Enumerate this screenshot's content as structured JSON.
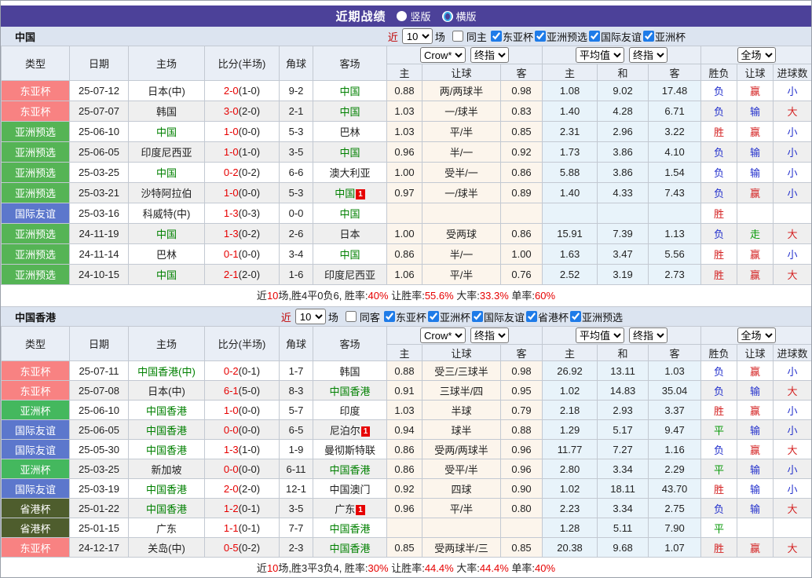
{
  "titlebar": {
    "title": "近期战绩",
    "options": [
      {
        "label": "竖版",
        "selected": true
      },
      {
        "label": "横版",
        "selected": false
      }
    ]
  },
  "columns": {
    "type": "类型",
    "date": "日期",
    "home": "主场",
    "score": "比分(半场)",
    "corner": "角球",
    "away": "客场",
    "bk_home": "主",
    "bk_handicap": "让球",
    "bk_away": "客",
    "avg_home": "主",
    "avg_draw": "和",
    "avg_away": "客",
    "res_wdl": "胜负",
    "res_handicap": "让球",
    "res_goals": "进球数"
  },
  "colors": {
    "accent_purple": "#4c4199",
    "self_team_green": "#008000",
    "score_red": "#e60000",
    "type_badges": {
      "东亚杯": "#f88282",
      "亚洲预选": "#55b455",
      "国际友谊": "#5c77cc",
      "亚洲杯": "#44b85e",
      "省港杯": "#4e5d2d"
    },
    "results": {
      "胜": "#d42222",
      "赢": "#d42222",
      "大": "#d42222",
      "负": "#2330cc",
      "输": "#2330cc",
      "小": "#2330cc",
      "平": "#0a9a0a",
      "走": "#0a9a0a"
    }
  },
  "sections": [
    {
      "team": "中国",
      "filter": {
        "near": "近",
        "count": "10",
        "games": "场",
        "same": "同主",
        "comps": [
          "东亚杯",
          "亚洲预选",
          "国际友谊",
          "亚洲杯"
        ]
      },
      "selects": {
        "bookmaker": "Crow*",
        "bk_period": "终指",
        "average": "平均值",
        "avg_period": "终指",
        "scope": "全场"
      },
      "rows": [
        {
          "type": "东亚杯",
          "date": "25-07-12",
          "home": "日本(中)",
          "home_self": false,
          "ft": "2-0",
          "ht": "(1-0)",
          "corner": "9-2",
          "away": "中国",
          "away_self": true,
          "mark": "",
          "bk": [
            "0.88",
            "两/两球半",
            "0.98"
          ],
          "avg": [
            "1.08",
            "9.02",
            "17.48"
          ],
          "res": [
            "负",
            "赢",
            "小"
          ]
        },
        {
          "type": "东亚杯",
          "date": "25-07-07",
          "home": "韩国",
          "home_self": false,
          "ft": "3-0",
          "ht": "(2-0)",
          "corner": "2-1",
          "away": "中国",
          "away_self": true,
          "mark": "",
          "bk": [
            "1.03",
            "一/球半",
            "0.83"
          ],
          "avg": [
            "1.40",
            "4.28",
            "6.71"
          ],
          "res": [
            "负",
            "输",
            "大"
          ]
        },
        {
          "type": "亚洲预选",
          "date": "25-06-10",
          "home": "中国",
          "home_self": true,
          "ft": "1-0",
          "ht": "(0-0)",
          "corner": "5-3",
          "away": "巴林",
          "away_self": false,
          "mark": "",
          "bk": [
            "1.03",
            "平/半",
            "0.85"
          ],
          "avg": [
            "2.31",
            "2.96",
            "3.22"
          ],
          "res": [
            "胜",
            "赢",
            "小"
          ]
        },
        {
          "type": "亚洲预选",
          "date": "25-06-05",
          "home": "印度尼西亚",
          "home_self": false,
          "ft": "1-0",
          "ht": "(1-0)",
          "corner": "3-5",
          "away": "中国",
          "away_self": true,
          "mark": "",
          "bk": [
            "0.96",
            "半/一",
            "0.92"
          ],
          "avg": [
            "1.73",
            "3.86",
            "4.10"
          ],
          "res": [
            "负",
            "输",
            "小"
          ]
        },
        {
          "type": "亚洲预选",
          "date": "25-03-25",
          "home": "中国",
          "home_self": true,
          "ft": "0-2",
          "ht": "(0-2)",
          "corner": "6-6",
          "away": "澳大利亚",
          "away_self": false,
          "mark": "",
          "bk": [
            "1.00",
            "受半/一",
            "0.86"
          ],
          "avg": [
            "5.88",
            "3.86",
            "1.54"
          ],
          "res": [
            "负",
            "输",
            "小"
          ]
        },
        {
          "type": "亚洲预选",
          "date": "25-03-21",
          "home": "沙特阿拉伯",
          "home_self": false,
          "ft": "1-0",
          "ht": "(0-0)",
          "corner": "5-3",
          "away": "中国",
          "away_self": true,
          "mark": "1",
          "bk": [
            "0.97",
            "一/球半",
            "0.89"
          ],
          "avg": [
            "1.40",
            "4.33",
            "7.43"
          ],
          "res": [
            "负",
            "赢",
            "小"
          ]
        },
        {
          "type": "国际友谊",
          "date": "25-03-16",
          "home": "科威特(中)",
          "home_self": false,
          "ft": "1-3",
          "ht": "(0-3)",
          "corner": "0-0",
          "away": "中国",
          "away_self": true,
          "mark": "",
          "bk": [
            "",
            "",
            ""
          ],
          "avg": [
            "",
            "",
            ""
          ],
          "res": [
            "胜",
            "",
            ""
          ]
        },
        {
          "type": "亚洲预选",
          "date": "24-11-19",
          "home": "中国",
          "home_self": true,
          "ft": "1-3",
          "ht": "(0-2)",
          "corner": "2-6",
          "away": "日本",
          "away_self": false,
          "mark": "",
          "bk": [
            "1.00",
            "受两球",
            "0.86"
          ],
          "avg": [
            "15.91",
            "7.39",
            "1.13"
          ],
          "res": [
            "负",
            "走",
            "大"
          ]
        },
        {
          "type": "亚洲预选",
          "date": "24-11-14",
          "home": "巴林",
          "home_self": false,
          "ft": "0-1",
          "ht": "(0-0)",
          "corner": "3-4",
          "away": "中国",
          "away_self": true,
          "mark": "",
          "bk": [
            "0.86",
            "半/一",
            "1.00"
          ],
          "avg": [
            "1.63",
            "3.47",
            "5.56"
          ],
          "res": [
            "胜",
            "赢",
            "小"
          ]
        },
        {
          "type": "亚洲预选",
          "date": "24-10-15",
          "home": "中国",
          "home_self": true,
          "ft": "2-1",
          "ht": "(2-0)",
          "corner": "1-6",
          "away": "印度尼西亚",
          "away_self": false,
          "mark": "",
          "bk": [
            "1.06",
            "平/半",
            "0.76"
          ],
          "avg": [
            "2.52",
            "3.19",
            "2.73"
          ],
          "res": [
            "胜",
            "赢",
            "大"
          ]
        }
      ],
      "summary": [
        [
          "近",
          "k"
        ],
        [
          "10",
          "r"
        ],
        [
          "场,胜4平0负6, 胜率:",
          "k"
        ],
        [
          "40%",
          "r"
        ],
        [
          " 让胜率:",
          "k"
        ],
        [
          "55.6%",
          "r"
        ],
        [
          " 大率:",
          "k"
        ],
        [
          "33.3%",
          "r"
        ],
        [
          " 单率:",
          "k"
        ],
        [
          "60%",
          "r"
        ]
      ]
    },
    {
      "team": "中国香港",
      "filter": {
        "near": "近",
        "count": "10",
        "games": "场",
        "same": "同客",
        "comps": [
          "东亚杯",
          "亚洲杯",
          "国际友谊",
          "省港杯",
          "亚洲预选"
        ]
      },
      "selects": {
        "bookmaker": "Crow*",
        "bk_period": "终指",
        "average": "平均值",
        "avg_period": "终指",
        "scope": "全场"
      },
      "rows": [
        {
          "type": "东亚杯",
          "date": "25-07-11",
          "home": "中国香港(中)",
          "home_self": true,
          "ft": "0-2",
          "ht": "(0-1)",
          "corner": "1-7",
          "away": "韩国",
          "away_self": false,
          "mark": "",
          "bk": [
            "0.88",
            "受三/三球半",
            "0.98"
          ],
          "avg": [
            "26.92",
            "13.11",
            "1.03"
          ],
          "res": [
            "负",
            "赢",
            "小"
          ]
        },
        {
          "type": "东亚杯",
          "date": "25-07-08",
          "home": "日本(中)",
          "home_self": false,
          "ft": "6-1",
          "ht": "(5-0)",
          "corner": "8-3",
          "away": "中国香港",
          "away_self": true,
          "mark": "",
          "bk": [
            "0.91",
            "三球半/四",
            "0.95"
          ],
          "avg": [
            "1.02",
            "14.83",
            "35.04"
          ],
          "res": [
            "负",
            "输",
            "大"
          ]
        },
        {
          "type": "亚洲杯",
          "date": "25-06-10",
          "home": "中国香港",
          "home_self": true,
          "ft": "1-0",
          "ht": "(0-0)",
          "corner": "5-7",
          "away": "印度",
          "away_self": false,
          "mark": "",
          "bk": [
            "1.03",
            "半球",
            "0.79"
          ],
          "avg": [
            "2.18",
            "2.93",
            "3.37"
          ],
          "res": [
            "胜",
            "赢",
            "小"
          ]
        },
        {
          "type": "国际友谊",
          "date": "25-06-05",
          "home": "中国香港",
          "home_self": true,
          "ft": "0-0",
          "ht": "(0-0)",
          "corner": "6-5",
          "away": "尼泊尔",
          "away_self": false,
          "mark": "1",
          "bk": [
            "0.94",
            "球半",
            "0.88"
          ],
          "avg": [
            "1.29",
            "5.17",
            "9.47"
          ],
          "res": [
            "平",
            "输",
            "小"
          ]
        },
        {
          "type": "国际友谊",
          "date": "25-05-30",
          "home": "中国香港",
          "home_self": true,
          "ft": "1-3",
          "ht": "(1-0)",
          "corner": "1-9",
          "away": "曼彻斯特联",
          "away_self": false,
          "mark": "",
          "bk": [
            "0.86",
            "受两/两球半",
            "0.96"
          ],
          "avg": [
            "11.77",
            "7.27",
            "1.16"
          ],
          "res": [
            "负",
            "赢",
            "大"
          ]
        },
        {
          "type": "亚洲杯",
          "date": "25-03-25",
          "home": "新加坡",
          "home_self": false,
          "ft": "0-0",
          "ht": "(0-0)",
          "corner": "6-11",
          "away": "中国香港",
          "away_self": true,
          "mark": "",
          "bk": [
            "0.86",
            "受平/半",
            "0.96"
          ],
          "avg": [
            "2.80",
            "3.34",
            "2.29"
          ],
          "res": [
            "平",
            "输",
            "小"
          ]
        },
        {
          "type": "国际友谊",
          "date": "25-03-19",
          "home": "中国香港",
          "home_self": true,
          "ft": "2-0",
          "ht": "(2-0)",
          "corner": "12-1",
          "away": "中国澳门",
          "away_self": false,
          "mark": "",
          "bk": [
            "0.92",
            "四球",
            "0.90"
          ],
          "avg": [
            "1.02",
            "18.11",
            "43.70"
          ],
          "res": [
            "胜",
            "输",
            "小"
          ]
        },
        {
          "type": "省港杯",
          "date": "25-01-22",
          "home": "中国香港",
          "home_self": true,
          "ft": "1-2",
          "ht": "(0-1)",
          "corner": "3-5",
          "away": "广东",
          "away_self": false,
          "mark": "1",
          "bk": [
            "0.96",
            "平/半",
            "0.80"
          ],
          "avg": [
            "2.23",
            "3.34",
            "2.75"
          ],
          "res": [
            "负",
            "输",
            "大"
          ]
        },
        {
          "type": "省港杯",
          "date": "25-01-15",
          "home": "广东",
          "home_self": false,
          "ft": "1-1",
          "ht": "(0-1)",
          "corner": "7-7",
          "away": "中国香港",
          "away_self": true,
          "mark": "",
          "bk": [
            "",
            "",
            ""
          ],
          "avg": [
            "1.28",
            "5.11",
            "7.90"
          ],
          "res": [
            "平",
            "",
            ""
          ]
        },
        {
          "type": "东亚杯",
          "date": "24-12-17",
          "home": "关岛(中)",
          "home_self": false,
          "ft": "0-5",
          "ht": "(0-2)",
          "corner": "2-3",
          "away": "中国香港",
          "away_self": true,
          "mark": "",
          "bk": [
            "0.85",
            "受两球半/三",
            "0.85"
          ],
          "avg": [
            "20.38",
            "9.68",
            "1.07"
          ],
          "res": [
            "胜",
            "赢",
            "大"
          ]
        }
      ],
      "summary": [
        [
          "近",
          "k"
        ],
        [
          "10",
          "r"
        ],
        [
          "场,胜3平3负4, 胜率:",
          "k"
        ],
        [
          "30%",
          "r"
        ],
        [
          " 让胜率:",
          "k"
        ],
        [
          "44.4%",
          "r"
        ],
        [
          " 大率:",
          "k"
        ],
        [
          "44.4%",
          "r"
        ],
        [
          " 单率:",
          "k"
        ],
        [
          "40%",
          "r"
        ]
      ]
    }
  ]
}
